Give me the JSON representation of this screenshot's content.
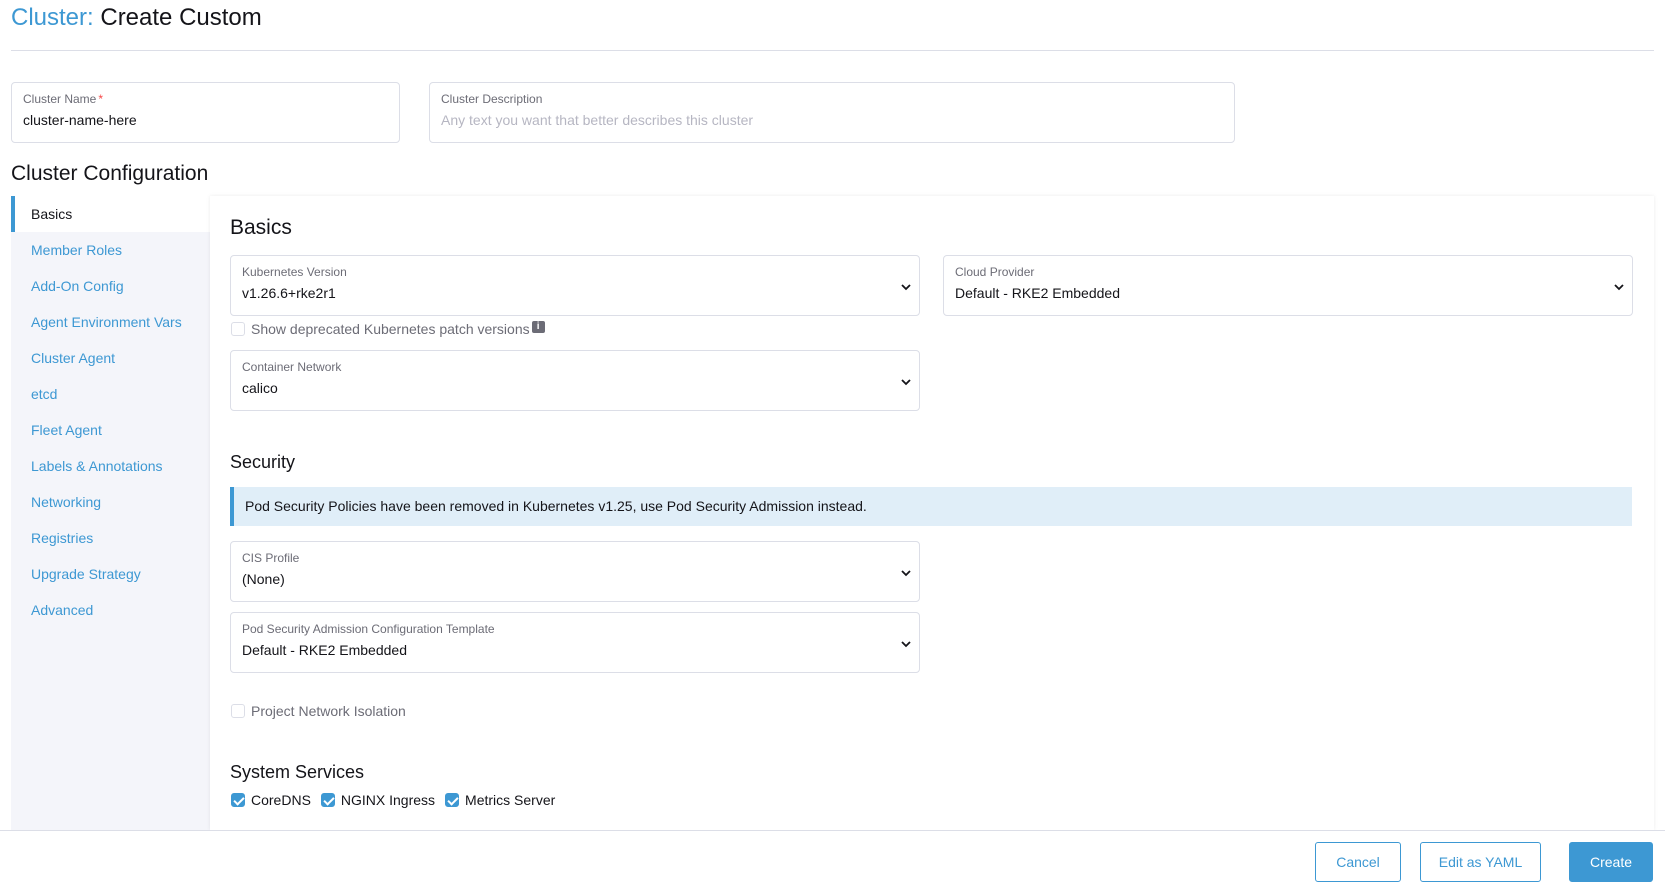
{
  "header": {
    "crumb": "Cluster:",
    "title": "Create Custom"
  },
  "cluster_name": {
    "label": "Cluster Name",
    "required_mark": "*",
    "value": "cluster-name-here"
  },
  "cluster_description": {
    "label": "Cluster Description",
    "placeholder": "Any text you want that better describes this cluster"
  },
  "config_title": "Cluster Configuration",
  "sidebar": {
    "items": [
      {
        "label": "Basics",
        "active": true
      },
      {
        "label": "Member Roles"
      },
      {
        "label": "Add-On Config"
      },
      {
        "label": "Agent Environment Vars"
      },
      {
        "label": "Cluster Agent"
      },
      {
        "label": "etcd"
      },
      {
        "label": "Fleet Agent"
      },
      {
        "label": "Labels & Annotations"
      },
      {
        "label": "Networking"
      },
      {
        "label": "Registries"
      },
      {
        "label": "Upgrade Strategy"
      },
      {
        "label": "Advanced"
      }
    ]
  },
  "basics": {
    "title": "Basics",
    "kubernetes_version": {
      "label": "Kubernetes Version",
      "value": "v1.26.6+rke2r1"
    },
    "cloud_provider": {
      "label": "Cloud Provider",
      "value": "Default - RKE2 Embedded"
    },
    "show_deprecated": {
      "label": "Show deprecated Kubernetes patch versions",
      "checked": false
    },
    "container_network": {
      "label": "Container Network",
      "value": "calico"
    }
  },
  "security": {
    "title": "Security",
    "banner": "Pod Security Policies have been removed in Kubernetes v1.25, use Pod Security Admission instead.",
    "cis_profile": {
      "label": "CIS Profile",
      "value": "(None)"
    },
    "psa_template": {
      "label": "Pod Security Admission Configuration Template",
      "value": "Default - RKE2 Embedded"
    },
    "project_network_isolation": {
      "label": "Project Network Isolation",
      "checked": false
    }
  },
  "system_services": {
    "title": "System Services",
    "items": [
      {
        "label": "CoreDNS",
        "checked": true
      },
      {
        "label": "NGINX Ingress",
        "checked": true
      },
      {
        "label": "Metrics Server",
        "checked": true
      }
    ]
  },
  "footer": {
    "cancel": "Cancel",
    "edit_yaml": "Edit as YAML",
    "create": "Create"
  },
  "colors": {
    "accent": "#3d98d3",
    "banner_bg": "#e0eef8",
    "sidebar_bg": "#f4f5fa"
  }
}
